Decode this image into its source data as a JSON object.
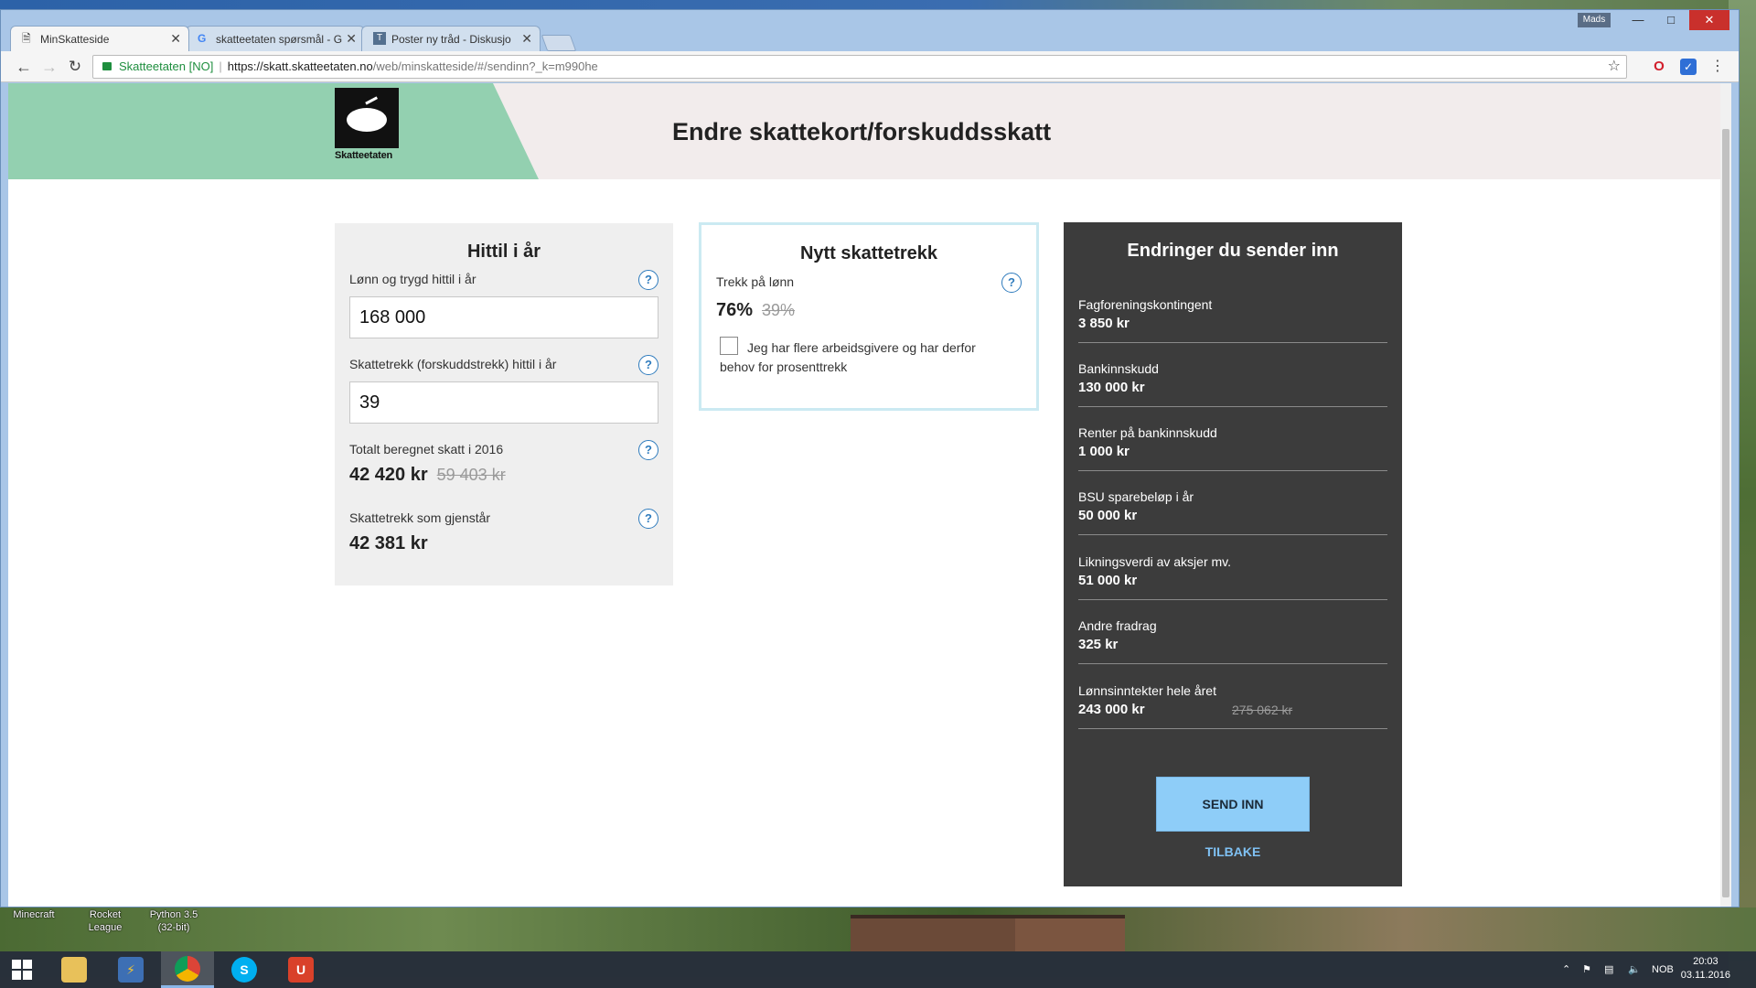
{
  "desktop": {
    "icons": [
      "Minecraft",
      "Rocket\nLeague",
      "Python 3.5\n(32-bit)"
    ]
  },
  "browser": {
    "user": "Mads",
    "tabs": [
      {
        "title": "MinSkatteside",
        "active": true
      },
      {
        "title": "skatteetaten spørsmål - G",
        "active": false
      },
      {
        "title": "Poster ny tråd - Diskusjo",
        "active": false
      }
    ],
    "address": {
      "secure_label": "Skatteetaten [NO]",
      "url_host": "https://skatt.skatteetaten.no",
      "url_rest": "/web/minskatteside/#/sendinn?_k=m990he"
    }
  },
  "header": {
    "logo_text": "Skatteetaten",
    "title": "Endre skattekort/forskuddsskatt"
  },
  "hittil": {
    "title": "Hittil i år",
    "salary_label": "Lønn og trygd hittil i år",
    "salary_value": "168 000",
    "withheld_label": "Skattetrekk (forskuddstrekk) hittil i år",
    "withheld_value": "39",
    "total_label": "Totalt beregnet skatt i 2016",
    "total_value": "42 420 kr",
    "total_old": "59 403 kr",
    "remaining_label": "Skattetrekk som gjenstår",
    "remaining_value": "42 381 kr",
    "help": "?"
  },
  "nytt": {
    "title": "Nytt skattetrekk",
    "label": "Trekk på lønn",
    "value": "76%",
    "old": "39%",
    "checkbox_label": "Jeg har flere arbeidsgivere og har derfor behov for prosenttrekk",
    "help": "?"
  },
  "endringer": {
    "title": "Endringer du sender inn",
    "items": [
      {
        "label": "Fagforeningskontingent",
        "value": "3 850 kr",
        "old": ""
      },
      {
        "label": "Bankinnskudd",
        "value": "130 000 kr",
        "old": ""
      },
      {
        "label": "Renter på bankinnskudd",
        "value": "1 000 kr",
        "old": ""
      },
      {
        "label": "BSU sparebeløp i år",
        "value": "50 000 kr",
        "old": ""
      },
      {
        "label": "Likningsverdi av aksjer mv.",
        "value": "51 000 kr",
        "old": ""
      },
      {
        "label": "Andre fradrag",
        "value": "325 kr",
        "old": ""
      },
      {
        "label": "Lønnsinntekter hele året",
        "value": "243 000 kr",
        "old": "275 062 kr"
      }
    ],
    "send_label": "SEND INN",
    "back_label": "TILBAKE"
  },
  "taskbar": {
    "language": "NOB",
    "time": "20:03",
    "date": "03.11.2016"
  },
  "colors": {
    "accent_green": "#93d0b0",
    "send_button": "#8ecdf8",
    "link": "#7fc1f3",
    "dark_panel": "#3c3c3c"
  }
}
